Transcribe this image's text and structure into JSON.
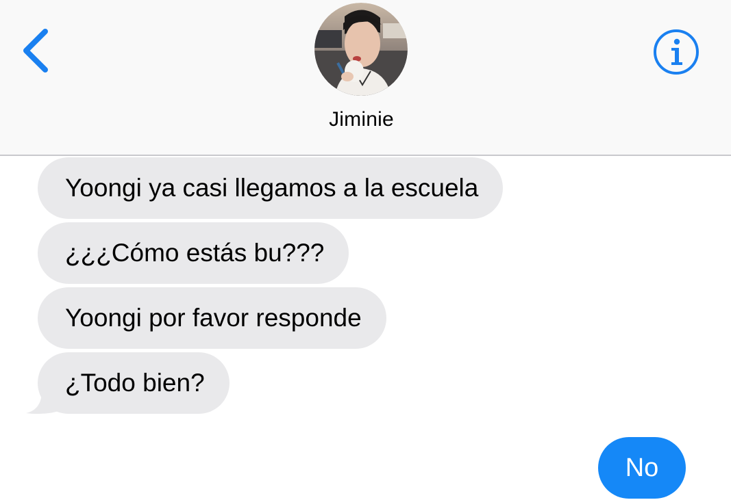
{
  "header": {
    "contact_name": "Jiminie",
    "back_icon": "chevron-left-icon",
    "info_icon": "info-icon",
    "accent_color": "#1a80f0"
  },
  "messages": {
    "incoming": [
      {
        "text": "Yoongi ya casi llegamos a la escuela"
      },
      {
        "text": "¿¿¿Cómo estás bu???"
      },
      {
        "text": "Yoongi por favor responde"
      },
      {
        "text": "¿Todo bien?"
      }
    ],
    "outgoing": [
      {
        "text": "No"
      }
    ],
    "incoming_color": "#e9e9eb",
    "outgoing_color": "#1588f7"
  }
}
